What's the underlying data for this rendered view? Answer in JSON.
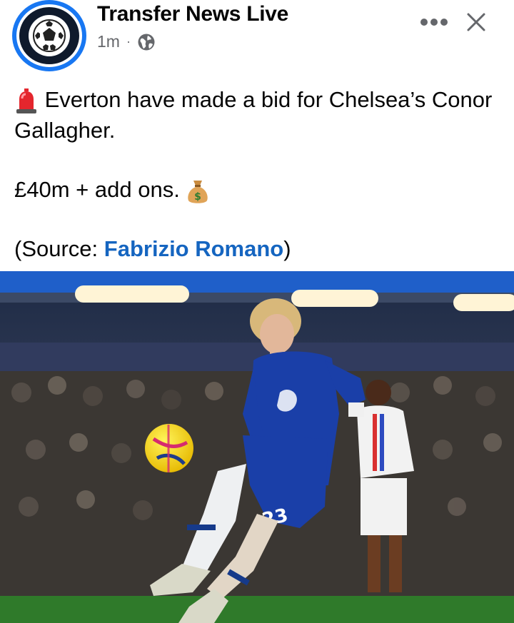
{
  "header": {
    "page_name": "Transfer News Live",
    "time": "1m",
    "separator": "·",
    "privacy_icon": "globe-icon",
    "more_icon": "more-dots-icon",
    "close_icon": "close-icon"
  },
  "post": {
    "line1_emoji": "siren-icon",
    "line1_text": "Everton have made a bid for Chelsea’s Conor Gallagher.",
    "line2_text": "£40m + add ons.",
    "line2_emoji": "money-bag-icon",
    "source_prefix": "(Source: ",
    "source_name": "Fabrizio Romano",
    "source_suffix": ")"
  },
  "photo": {
    "shirt_number": "23"
  },
  "colors": {
    "brand_blue": "#1877f2",
    "link_blue": "#1565c0",
    "kit_blue": "#1a3fa8"
  }
}
